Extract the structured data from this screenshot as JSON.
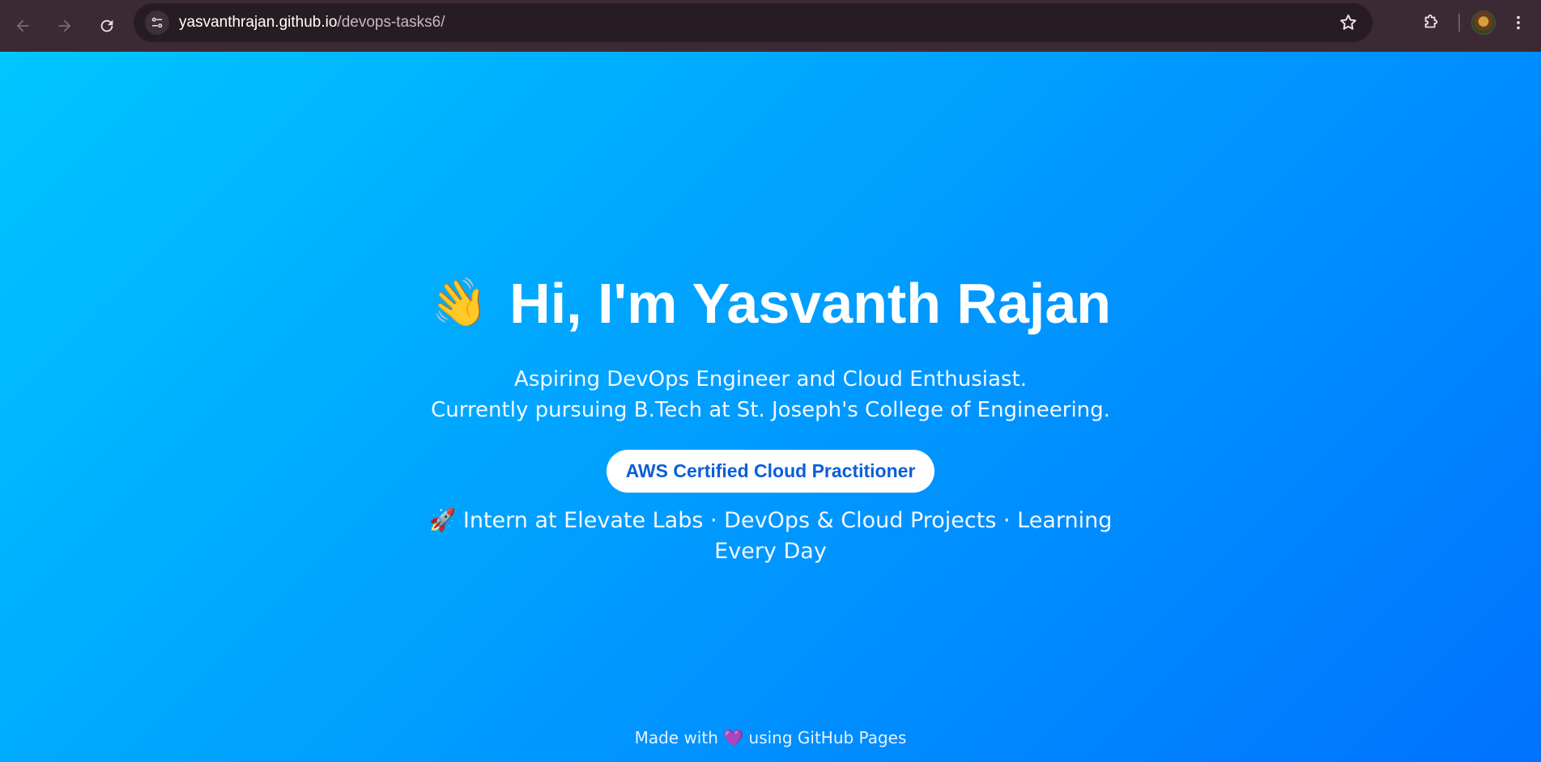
{
  "browser": {
    "url_domain": "yasvanthrajan.github.io",
    "url_path": "/devops-tasks6/",
    "icons": [
      "back-arrow-icon",
      "forward-arrow-icon",
      "reload-icon",
      "site-info-icon",
      "star-icon",
      "extensions-icon",
      "avatar",
      "more-vert-icon"
    ]
  },
  "hero": {
    "wave_emoji": "👋",
    "heading": "Hi, I'm Yasvanth Rajan",
    "tagline_line1": "Aspiring DevOps Engineer and Cloud Enthusiast.",
    "tagline_line2": "Currently pursuing B.Tech at St. Joseph's College of Engineering.",
    "badge": "AWS Certified Cloud Practitioner",
    "rocket_emoji": "🚀",
    "subline": "Intern at Elevate Labs · DevOps & Cloud Projects · Learning Every Day"
  },
  "footer": {
    "prefix": "Made with",
    "heart": "💜",
    "suffix": "using GitHub Pages"
  },
  "colors": {
    "gradient_start": "#00c6ff",
    "gradient_end": "#0072ff",
    "badge_text": "#0a5ed8",
    "chrome_bg": "#3b2a34"
  }
}
